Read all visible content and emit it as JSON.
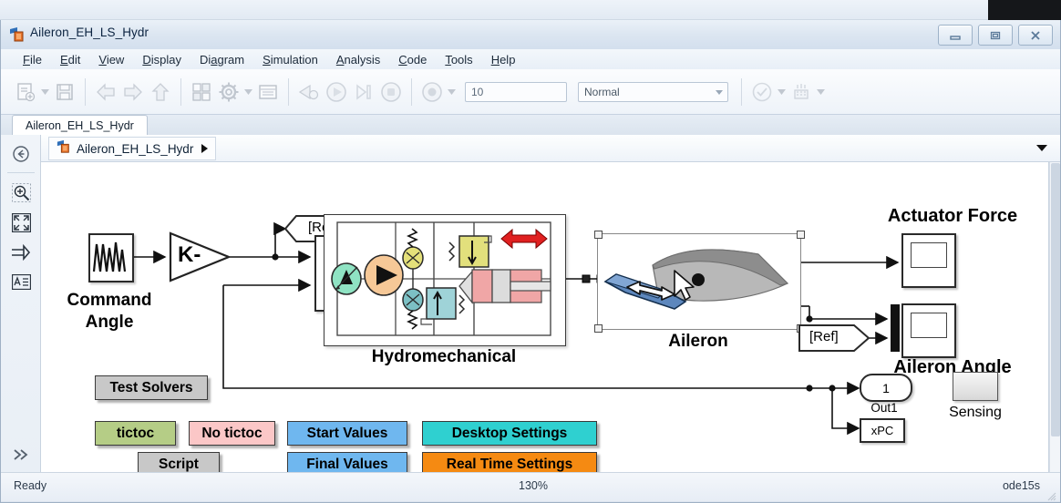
{
  "window": {
    "title": "Aileron_EH_LS_Hydr",
    "icon": "simulink-model-icon",
    "controls": {
      "minimize": "minimize-button",
      "restore": "restore-button",
      "close": "close-button"
    }
  },
  "menu": {
    "items": [
      {
        "label": "File",
        "mnemonic": "F"
      },
      {
        "label": "Edit",
        "mnemonic": "E"
      },
      {
        "label": "View",
        "mnemonic": "V"
      },
      {
        "label": "Display",
        "mnemonic": "D"
      },
      {
        "label": "Diagram",
        "mnemonic": "a"
      },
      {
        "label": "Simulation",
        "mnemonic": "S"
      },
      {
        "label": "Analysis",
        "mnemonic": "A"
      },
      {
        "label": "Code",
        "mnemonic": "C"
      },
      {
        "label": "Tools",
        "mnemonic": "T"
      },
      {
        "label": "Help",
        "mnemonic": "H"
      }
    ]
  },
  "toolbar": {
    "buttons": [
      "new-model-icon",
      "new-model-dropdown-caret",
      "save-icon",
      "back-icon",
      "forward-icon",
      "up-to-parent-icon",
      "library-browser-icon",
      "model-configuration-icon",
      "model-configuration-caret",
      "model-explorer-icon",
      "update-diagram-icon",
      "run-icon",
      "step-forward-icon",
      "stop-icon",
      "record-icon",
      "record-caret",
      "model-advisor-icon",
      "model-advisor-caret",
      "data-inspector-icon",
      "data-inspector-caret"
    ],
    "stop_time": {
      "value": "10",
      "name": "simulation-stop-time-field"
    },
    "sim_mode": {
      "value": "Normal",
      "name": "simulation-mode-select"
    }
  },
  "tab": {
    "label": "Aileron_EH_LS_Hydr"
  },
  "breadcrumb": {
    "label": "Aileron_EH_LS_Hydr",
    "icon": "simulink-model-icon"
  },
  "rail": {
    "items": [
      "navigate-back-icon",
      "zoom-in-icon",
      "fit-to-view-icon",
      "signal-routing-icon",
      "annotation-icon",
      "expand-palette-icon"
    ]
  },
  "diagram": {
    "blocks": {
      "command_angle": {
        "label": "Command\nAngle",
        "label_line1": "Command",
        "label_line2": "Angle",
        "type": "signal-generator"
      },
      "gain": {
        "label": "K-",
        "type": "gain"
      },
      "sum": {
        "plus": "+",
        "minus": "−",
        "type": "sum"
      },
      "goto_ref": {
        "label": "[Ref]",
        "type": "goto-tag"
      },
      "from_ref": {
        "label": "[Ref]",
        "type": "from-tag"
      },
      "hydromechanical": {
        "label": "Hydromechanical",
        "type": "subsystem"
      },
      "aileron": {
        "label": "Aileron",
        "type": "subsystem",
        "selected": true
      },
      "actuator_force_scope": {
        "label": "Actuator Force",
        "type": "scope"
      },
      "aileron_angle_scope": {
        "label": "Aileron Angle",
        "type": "scope"
      },
      "sensing": {
        "label": "Sensing",
        "type": "subsystem-placeholder"
      },
      "out1": {
        "label": "1",
        "caption": "Out1",
        "type": "outport"
      },
      "xpc": {
        "label": "xPC",
        "type": "block"
      }
    },
    "annotations": [
      {
        "id": "test-solvers",
        "label": "Test Solvers",
        "fill": "#c8c8c8",
        "text": "#000000"
      },
      {
        "id": "tictoc",
        "label": "tictoc",
        "fill": "#b5cd86",
        "text": "#000000"
      },
      {
        "id": "no-tictoc",
        "label": "No tictoc",
        "fill": "#fbc7c7",
        "text": "#000000"
      },
      {
        "id": "script",
        "label": "Script",
        "fill": "#c8c8c8",
        "text": "#000000"
      },
      {
        "id": "start-values",
        "label": "Start Values",
        "fill": "#6fb7ef",
        "text": "#000000"
      },
      {
        "id": "final-values",
        "label": "Final Values",
        "fill": "#6fb7ef",
        "text": "#000000"
      },
      {
        "id": "desktop-settings",
        "label": "Desktop Settings",
        "fill": "#2fd0d0",
        "text": "#000000"
      },
      {
        "id": "real-time-settings",
        "label": "Real Time Settings",
        "fill": "#f58a12",
        "text": "#000000"
      }
    ]
  },
  "statusbar": {
    "ready": "Ready",
    "zoom": "130%",
    "solver": "ode15s"
  }
}
